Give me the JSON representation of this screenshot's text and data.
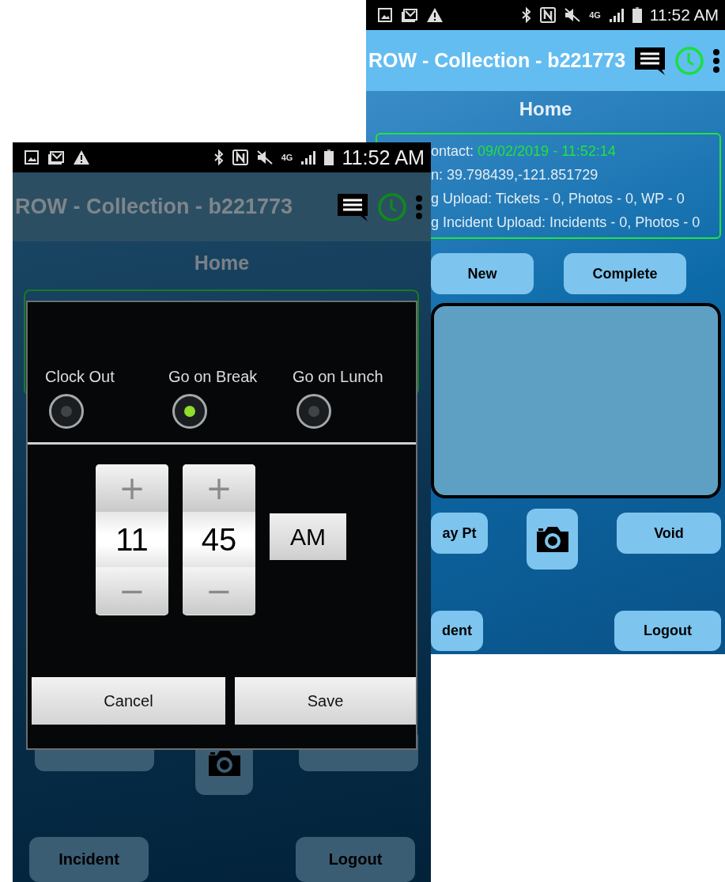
{
  "back_screen": {
    "status_bar": {
      "network": "4G",
      "time": "11:52 AM"
    },
    "app_bar": {
      "title": "ROW - Collection - b221773"
    },
    "page_title": "Home",
    "info_lines": [
      {
        "label": "ontact:",
        "value": "09/02/2019 - 11:52:14"
      },
      {
        "label": "n: 39.798439,-121.851729"
      },
      {
        "label": "g Upload: Tickets - 0, Photos - 0, WP - 0"
      },
      {
        "label": "g Incident Upload: Incidents - 0, Photos - 0"
      }
    ],
    "top_buttons": [
      "New",
      "Complete"
    ],
    "middle_buttons": [
      {
        "kind": "text",
        "label": "ay Pt"
      },
      {
        "kind": "camera"
      },
      {
        "kind": "text",
        "label": "Void"
      }
    ],
    "bottom_buttons": [
      "dent",
      "Logout"
    ]
  },
  "front_screen": {
    "status_bar": {
      "network": "4G",
      "time": "11:52 AM"
    },
    "app_bar": {
      "title": "ROW - Collection - b221773"
    },
    "page_title": "Home",
    "middle_buttons": [
      {
        "kind": "blank"
      },
      {
        "kind": "camera"
      },
      {
        "kind": "blank"
      }
    ],
    "bottom_buttons": [
      "Incident",
      "Logout"
    ],
    "dialog": {
      "options": [
        {
          "label": "Clock Out",
          "selected": false
        },
        {
          "label": "Go on Break",
          "selected": true
        },
        {
          "label": "Go on Lunch",
          "selected": false
        }
      ],
      "pickers": [
        {
          "up": "+",
          "value": "11",
          "down": "−"
        },
        {
          "up": "+",
          "value": "45",
          "down": "−"
        }
      ],
      "meridiem": "AM",
      "actions": [
        "Cancel",
        "Save"
      ]
    }
  }
}
